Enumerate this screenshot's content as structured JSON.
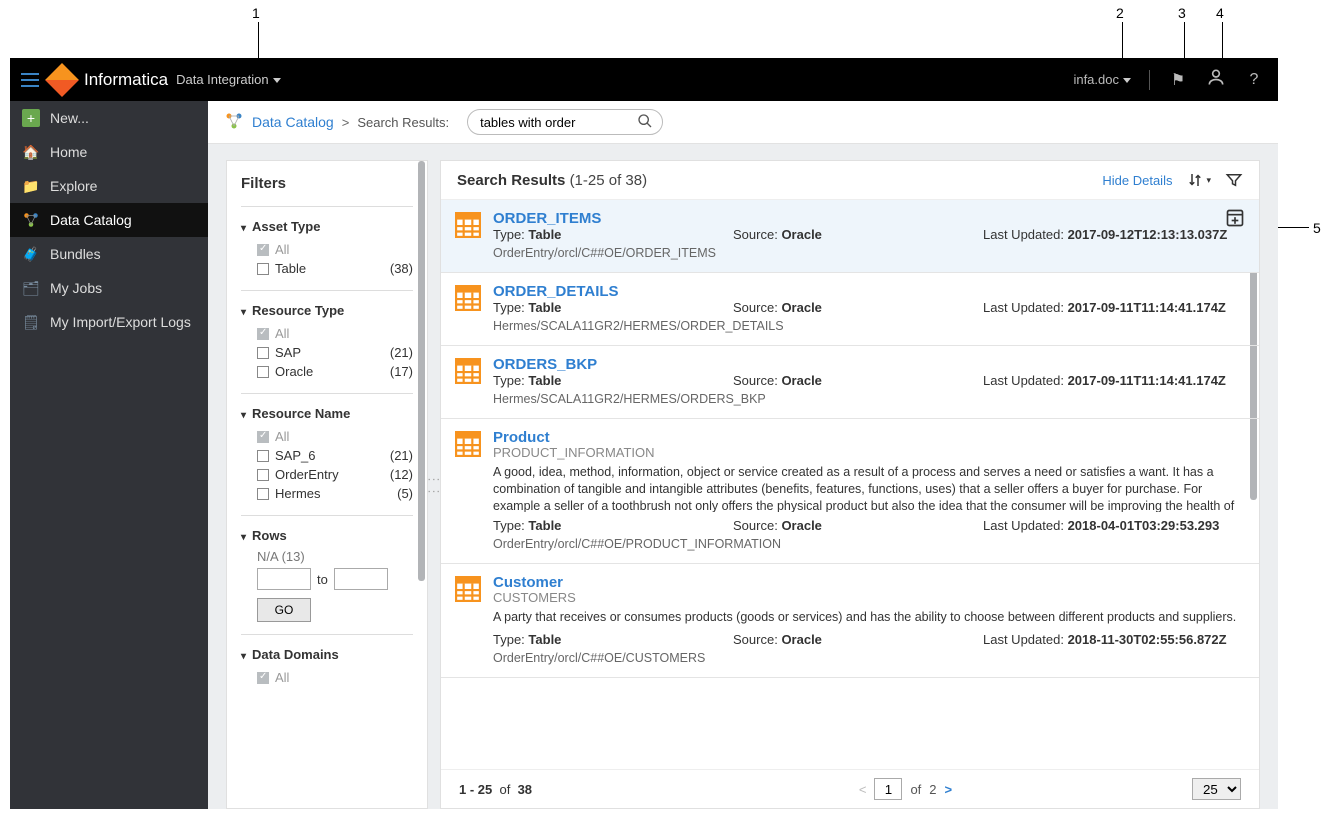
{
  "callouts": {
    "c1": "1",
    "c2": "2",
    "c3": "3",
    "c4": "4",
    "c5": "5"
  },
  "topbar": {
    "brand": "Informatica",
    "product": "Data Integration",
    "user": "infa.doc",
    "help": "?"
  },
  "sidebar": {
    "items": [
      {
        "label": "New..."
      },
      {
        "label": "Home"
      },
      {
        "label": "Explore"
      },
      {
        "label": "Data Catalog"
      },
      {
        "label": "Bundles"
      },
      {
        "label": "My Jobs"
      },
      {
        "label": "My Import/Export Logs"
      }
    ]
  },
  "crumb": {
    "root": "Data Catalog",
    "sep": ">",
    "page": "Search Results:",
    "search_value": "tables with order"
  },
  "filters": {
    "title": "Filters",
    "groups": {
      "asset_type": {
        "title": "Asset Type",
        "all": "All",
        "opts": [
          {
            "label": "Table",
            "count": "(38)"
          }
        ]
      },
      "resource_type": {
        "title": "Resource Type",
        "all": "All",
        "opts": [
          {
            "label": "SAP",
            "count": "(21)"
          },
          {
            "label": "Oracle",
            "count": "(17)"
          }
        ]
      },
      "resource_name": {
        "title": "Resource Name",
        "all": "All",
        "opts": [
          {
            "label": "SAP_6",
            "count": "(21)"
          },
          {
            "label": "OrderEntry",
            "count": "(12)"
          },
          {
            "label": "Hermes",
            "count": "(5)"
          }
        ]
      },
      "rows": {
        "title": "Rows",
        "na": "N/A (13)",
        "to": "to",
        "go": "GO"
      },
      "data_domains": {
        "title": "Data Domains",
        "all": "All"
      }
    }
  },
  "results": {
    "heading": "Search Results",
    "count": "(1-25 of 38)",
    "hide": "Hide Details",
    "type_label": "Type:",
    "source_label": "Source:",
    "updated_label": "Last Updated:",
    "items": [
      {
        "name": "ORDER_ITEMS",
        "sub": "",
        "type": "Table",
        "source": "Oracle",
        "updated": "2017-09-12T12:13:13.037Z",
        "path": "OrderEntry/orcl/C##OE/ORDER_ITEMS",
        "desc": ""
      },
      {
        "name": "ORDER_DETAILS",
        "sub": "",
        "type": "Table",
        "source": "Oracle",
        "updated": "2017-09-11T11:14:41.174Z",
        "path": "Hermes/SCALA11GR2/HERMES/ORDER_DETAILS",
        "desc": ""
      },
      {
        "name": "ORDERS_BKP",
        "sub": "",
        "type": "Table",
        "source": "Oracle",
        "updated": "2017-09-11T11:14:41.174Z",
        "path": "Hermes/SCALA11GR2/HERMES/ORDERS_BKP",
        "desc": ""
      },
      {
        "name": "Product",
        "sub": "PRODUCT_INFORMATION",
        "type": "Table",
        "source": "Oracle",
        "updated": "2018-04-01T03:29:53.293",
        "path": "OrderEntry/orcl/C##OE/PRODUCT_INFORMATION",
        "desc": "A good, idea, method, information, object or service created as a result of a process and serves a need or satisfies a want. It has a combination of tangible and intangible attributes (benefits, features, functions, uses) that a seller offers a buyer for purchase. For example a seller of a toothbrush not only offers the physical product but also the idea that the consumer will be improving the health of their teeth.Law: A commercially"
      },
      {
        "name": "Customer",
        "sub": "CUSTOMERS",
        "type": "Table",
        "source": "Oracle",
        "updated": "2018-11-30T02:55:56.872Z",
        "path": "OrderEntry/orcl/C##OE/CUSTOMERS",
        "desc": "A party that receives or consumes products (goods or services) and has the ability to choose between different products and suppliers."
      }
    ],
    "pager": {
      "range": "1 - 25",
      "of": "of",
      "total": "38",
      "page": "1",
      "pages": "2",
      "size": "25"
    }
  }
}
